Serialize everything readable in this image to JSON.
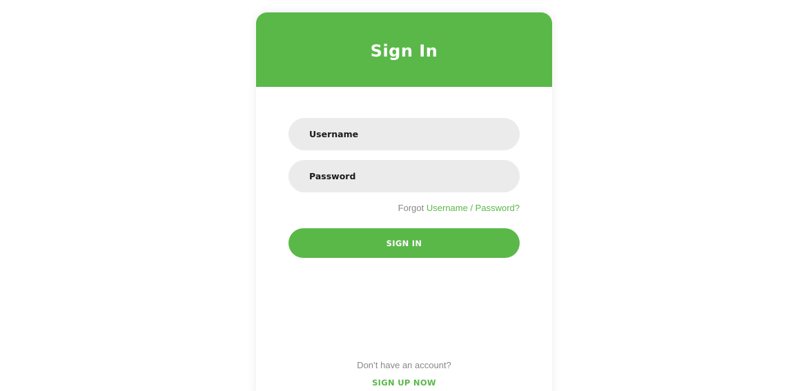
{
  "colors": {
    "brand_green": "#5ab849",
    "field_background": "#ebebeb",
    "muted_text": "#888888"
  },
  "header": {
    "title": "Sign In"
  },
  "form": {
    "username_placeholder": "Username",
    "password_placeholder": "Password",
    "forgot_prefix": "Forgot",
    "forgot_link": "Username / Password?",
    "submit_label": "SIGN IN"
  },
  "footer": {
    "prompt": "Don’t have an account?",
    "signup_label": "SIGN UP NOW"
  }
}
